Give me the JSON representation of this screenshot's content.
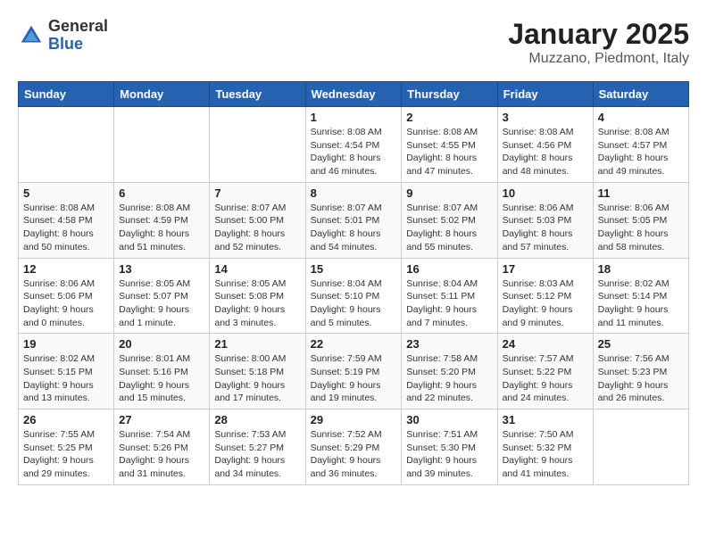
{
  "header": {
    "logo_general": "General",
    "logo_blue": "Blue",
    "month_title": "January 2025",
    "location": "Muzzano, Piedmont, Italy"
  },
  "weekdays": [
    "Sunday",
    "Monday",
    "Tuesday",
    "Wednesday",
    "Thursday",
    "Friday",
    "Saturday"
  ],
  "weeks": [
    [
      {
        "day": "",
        "info": ""
      },
      {
        "day": "",
        "info": ""
      },
      {
        "day": "",
        "info": ""
      },
      {
        "day": "1",
        "info": "Sunrise: 8:08 AM\nSunset: 4:54 PM\nDaylight: 8 hours\nand 46 minutes."
      },
      {
        "day": "2",
        "info": "Sunrise: 8:08 AM\nSunset: 4:55 PM\nDaylight: 8 hours\nand 47 minutes."
      },
      {
        "day": "3",
        "info": "Sunrise: 8:08 AM\nSunset: 4:56 PM\nDaylight: 8 hours\nand 48 minutes."
      },
      {
        "day": "4",
        "info": "Sunrise: 8:08 AM\nSunset: 4:57 PM\nDaylight: 8 hours\nand 49 minutes."
      }
    ],
    [
      {
        "day": "5",
        "info": "Sunrise: 8:08 AM\nSunset: 4:58 PM\nDaylight: 8 hours\nand 50 minutes."
      },
      {
        "day": "6",
        "info": "Sunrise: 8:08 AM\nSunset: 4:59 PM\nDaylight: 8 hours\nand 51 minutes."
      },
      {
        "day": "7",
        "info": "Sunrise: 8:07 AM\nSunset: 5:00 PM\nDaylight: 8 hours\nand 52 minutes."
      },
      {
        "day": "8",
        "info": "Sunrise: 8:07 AM\nSunset: 5:01 PM\nDaylight: 8 hours\nand 54 minutes."
      },
      {
        "day": "9",
        "info": "Sunrise: 8:07 AM\nSunset: 5:02 PM\nDaylight: 8 hours\nand 55 minutes."
      },
      {
        "day": "10",
        "info": "Sunrise: 8:06 AM\nSunset: 5:03 PM\nDaylight: 8 hours\nand 57 minutes."
      },
      {
        "day": "11",
        "info": "Sunrise: 8:06 AM\nSunset: 5:05 PM\nDaylight: 8 hours\nand 58 minutes."
      }
    ],
    [
      {
        "day": "12",
        "info": "Sunrise: 8:06 AM\nSunset: 5:06 PM\nDaylight: 9 hours\nand 0 minutes."
      },
      {
        "day": "13",
        "info": "Sunrise: 8:05 AM\nSunset: 5:07 PM\nDaylight: 9 hours\nand 1 minute."
      },
      {
        "day": "14",
        "info": "Sunrise: 8:05 AM\nSunset: 5:08 PM\nDaylight: 9 hours\nand 3 minutes."
      },
      {
        "day": "15",
        "info": "Sunrise: 8:04 AM\nSunset: 5:10 PM\nDaylight: 9 hours\nand 5 minutes."
      },
      {
        "day": "16",
        "info": "Sunrise: 8:04 AM\nSunset: 5:11 PM\nDaylight: 9 hours\nand 7 minutes."
      },
      {
        "day": "17",
        "info": "Sunrise: 8:03 AM\nSunset: 5:12 PM\nDaylight: 9 hours\nand 9 minutes."
      },
      {
        "day": "18",
        "info": "Sunrise: 8:02 AM\nSunset: 5:14 PM\nDaylight: 9 hours\nand 11 minutes."
      }
    ],
    [
      {
        "day": "19",
        "info": "Sunrise: 8:02 AM\nSunset: 5:15 PM\nDaylight: 9 hours\nand 13 minutes."
      },
      {
        "day": "20",
        "info": "Sunrise: 8:01 AM\nSunset: 5:16 PM\nDaylight: 9 hours\nand 15 minutes."
      },
      {
        "day": "21",
        "info": "Sunrise: 8:00 AM\nSunset: 5:18 PM\nDaylight: 9 hours\nand 17 minutes."
      },
      {
        "day": "22",
        "info": "Sunrise: 7:59 AM\nSunset: 5:19 PM\nDaylight: 9 hours\nand 19 minutes."
      },
      {
        "day": "23",
        "info": "Sunrise: 7:58 AM\nSunset: 5:20 PM\nDaylight: 9 hours\nand 22 minutes."
      },
      {
        "day": "24",
        "info": "Sunrise: 7:57 AM\nSunset: 5:22 PM\nDaylight: 9 hours\nand 24 minutes."
      },
      {
        "day": "25",
        "info": "Sunrise: 7:56 AM\nSunset: 5:23 PM\nDaylight: 9 hours\nand 26 minutes."
      }
    ],
    [
      {
        "day": "26",
        "info": "Sunrise: 7:55 AM\nSunset: 5:25 PM\nDaylight: 9 hours\nand 29 minutes."
      },
      {
        "day": "27",
        "info": "Sunrise: 7:54 AM\nSunset: 5:26 PM\nDaylight: 9 hours\nand 31 minutes."
      },
      {
        "day": "28",
        "info": "Sunrise: 7:53 AM\nSunset: 5:27 PM\nDaylight: 9 hours\nand 34 minutes."
      },
      {
        "day": "29",
        "info": "Sunrise: 7:52 AM\nSunset: 5:29 PM\nDaylight: 9 hours\nand 36 minutes."
      },
      {
        "day": "30",
        "info": "Sunrise: 7:51 AM\nSunset: 5:30 PM\nDaylight: 9 hours\nand 39 minutes."
      },
      {
        "day": "31",
        "info": "Sunrise: 7:50 AM\nSunset: 5:32 PM\nDaylight: 9 hours\nand 41 minutes."
      },
      {
        "day": "",
        "info": ""
      }
    ]
  ]
}
